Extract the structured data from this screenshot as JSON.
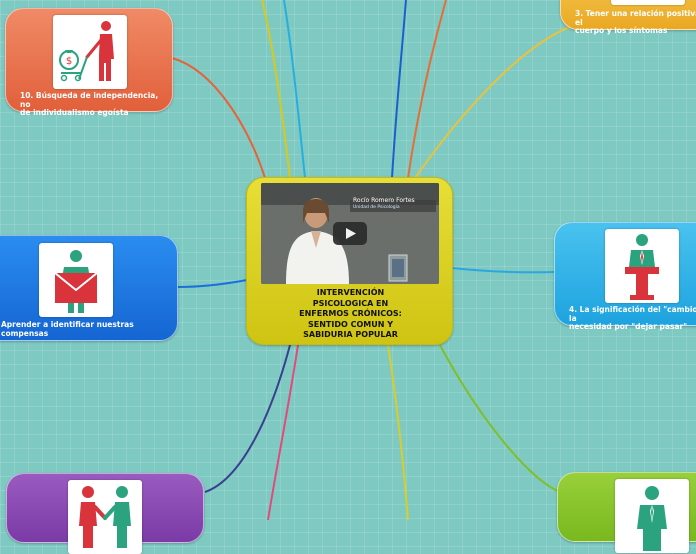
{
  "central": {
    "title": "INTERVENCIÓN\nPSICOLOGICA EN\nENFERMOS CRÓNICOS:\nSENTIDO COMUN Y\nSABIDURIA POPULAR",
    "video_caption_name": "Rocío Romero Fortes",
    "video_caption_role": "Unidad de Psicología"
  },
  "nodes": {
    "n10": {
      "label": "10. Búsqueda de independencia, no\nde individualismo egoísta",
      "icon": "person-pushing-money-cart-icon",
      "color": "#e8714c"
    },
    "n1": {
      "label": "Aprender a identificar nuestras\ncompensas",
      "icon": "person-with-envelope-icon",
      "color": "#1e78e0"
    },
    "n3": {
      "label": "3. Tener una relación positiva con el\ncuerpo y los síntomas",
      "icon": "",
      "color": "#efb535"
    },
    "n4": {
      "label": "4. La significación del \"cambio\" vs la\nnecesidad por \"dejar pasar\"",
      "icon": "person-at-podium-icon",
      "color": "#31b1e6"
    },
    "n_bl": {
      "label": "",
      "icon": "handshake-people-icon",
      "color": "#8a49b3"
    },
    "n_br": {
      "label": "",
      "icon": "person-standing-icon",
      "color": "#88c42c"
    }
  },
  "colors": {
    "background": "#7fc9c3",
    "icon_accent_green": "#2aa37e",
    "icon_accent_red": "#d9333b"
  }
}
